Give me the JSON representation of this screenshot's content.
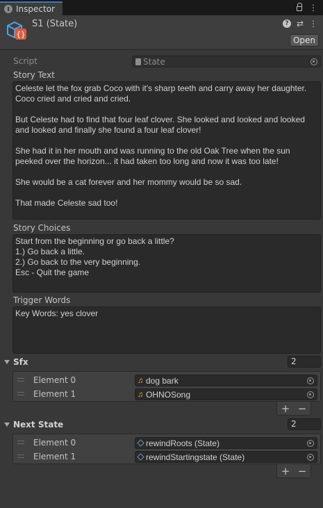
{
  "tab": {
    "title": "Inspector"
  },
  "header": {
    "object_title": "S1 (State)",
    "open_label": "Open"
  },
  "script": {
    "label": "Script",
    "value": "State"
  },
  "story_text": {
    "label": "Story Text",
    "value": "Celeste let the fox grab Coco with it's sharp teeth and carry away her daughter. Coco cried and cried and cried.\n\nBut Celeste had to find that four leaf clover. She looked and looked and looked and looked and finally she found a four leaf clover!\n\nShe had it in her mouth and was running to the old Oak Tree when the sun peeked over the horizon... it had taken too long and now it was too late!\n\nShe would be a cat forever and her mommy would be so sad.\n\nThat made Celeste sad too!"
  },
  "story_choices": {
    "label": "Story Choices",
    "value": "Start from the beginning or go back a little?\n1.) Go back a little.\n2.) Go back to the very beginning.\nEsc - Quit the game"
  },
  "trigger_words": {
    "label": "Trigger Words",
    "value": "Key Words: yes clover"
  },
  "sfx": {
    "label": "Sfx",
    "count": "2",
    "items": [
      {
        "label": "Element 0",
        "value": "dog bark",
        "icon": "audio-clip-icon"
      },
      {
        "label": "Element 1",
        "value": "OHNOSong",
        "icon": "audio-clip-icon"
      }
    ],
    "add_label": "+",
    "remove_label": "−"
  },
  "next_state": {
    "label": "Next State",
    "count": "2",
    "items": [
      {
        "label": "Element 0",
        "value": "rewindRoots (State)",
        "icon": "scriptable-object-icon"
      },
      {
        "label": "Element 1",
        "value": "rewindStartingstate (State)",
        "icon": "scriptable-object-icon"
      }
    ],
    "add_label": "+",
    "remove_label": "−"
  },
  "colors": {
    "background": "#383838",
    "tab_accent": "#3a79bb",
    "field_bg": "#2a2a2a",
    "audio_icon": "#e6b84a"
  }
}
